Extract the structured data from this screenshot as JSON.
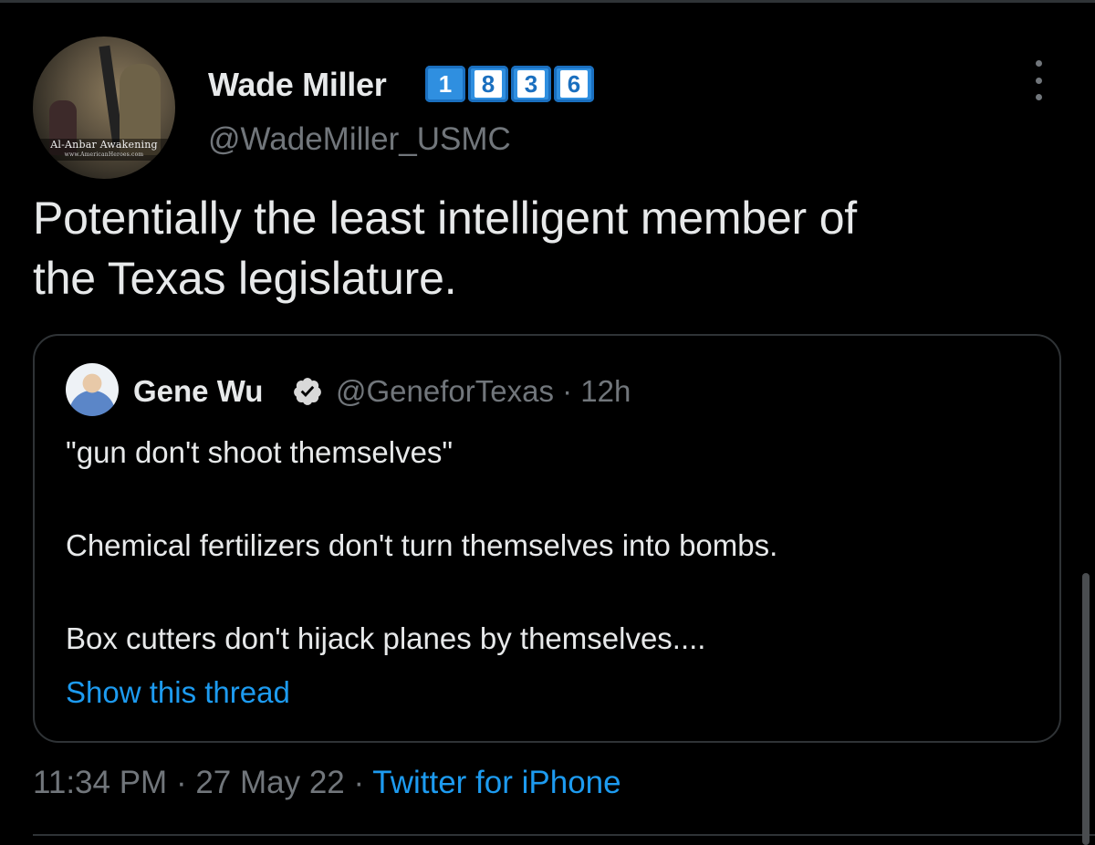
{
  "author": {
    "name": "Wade Miller",
    "badges": [
      "1",
      "8",
      "3",
      "6"
    ],
    "handle": "@WadeMiller_USMC",
    "avatar_caption": "Al-Anbar Awakening",
    "avatar_subcaption": "www.AmericanHeroes.com",
    "more_icon": "more-vertical-icon"
  },
  "tweet": {
    "lines": [
      "Potentially the least intelligent member of",
      "the Texas legislature."
    ]
  },
  "quote": {
    "name": "Gene Wu",
    "verified_icon": "verified-badge-icon",
    "handle_time": "@GeneforTexas · 12h",
    "paragraphs": [
      "\"gun don't shoot themselves\"",
      "Chemical fertilizers don't turn themselves into bombs.",
      "Box cutters don't hijack planes by themselves...."
    ],
    "show_thread": "Show this thread"
  },
  "meta": {
    "time": "11:34 PM",
    "sep1": " · ",
    "date": "27 May 22",
    "sep2": " · ",
    "source": "Twitter for iPhone"
  },
  "colors": {
    "background": "#000000",
    "text": "#e7e9ea",
    "muted": "#71767b",
    "link": "#1d9bf0",
    "border": "#2f3336",
    "badge": "#2f8fe0"
  }
}
